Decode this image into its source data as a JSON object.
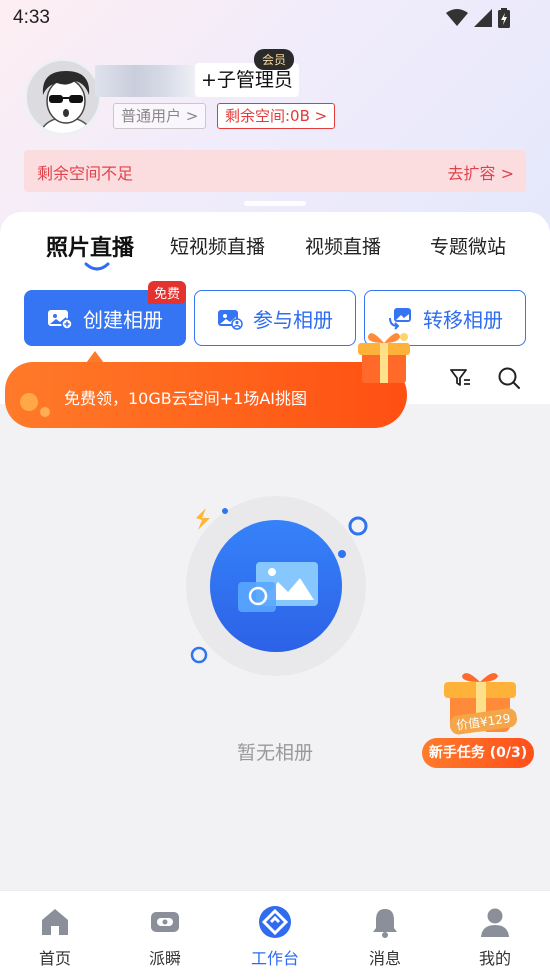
{
  "status_bar": {
    "time": "4:33"
  },
  "profile": {
    "role_label": "+子管理员",
    "vip_badge": "会员",
    "user_type": "普通用户 >",
    "space_tag": "剩余空间:0B >"
  },
  "warning": {
    "text": "剩余空间不足",
    "link": "去扩容 >"
  },
  "tabs": [
    {
      "label": "照片直播",
      "active": true
    },
    {
      "label": "短视频直播",
      "active": false
    },
    {
      "label": "视频直播",
      "active": false
    },
    {
      "label": "专题微站",
      "active": false
    }
  ],
  "actions": {
    "create": "创建相册",
    "join": "参与相册",
    "transfer": "转移相册",
    "free_badge": "免费"
  },
  "promo": {
    "text": "免费领，10GB云空间+1场AI挑图"
  },
  "empty": {
    "text": "暂无相册"
  },
  "newbie": {
    "label": "新手任务 (0/3)",
    "value": "价值¥129"
  },
  "nav": [
    {
      "label": "首页",
      "icon": "home-icon"
    },
    {
      "label": "派瞬",
      "icon": "paishun-icon"
    },
    {
      "label": "工作台",
      "icon": "workbench-icon"
    },
    {
      "label": "消息",
      "icon": "bell-icon"
    },
    {
      "label": "我的",
      "icon": "user-icon"
    }
  ],
  "colors": {
    "accent": "#3574f3",
    "warning": "#e0434a",
    "promo": "#ff6a1f"
  }
}
